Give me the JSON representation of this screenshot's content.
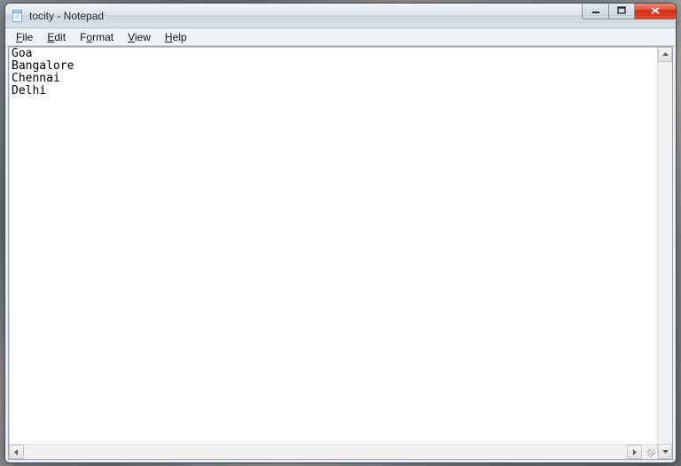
{
  "window": {
    "title": "tocity - Notepad"
  },
  "menubar": {
    "file": {
      "label": "File",
      "accel": "F"
    },
    "edit": {
      "label": "Edit",
      "accel": "E"
    },
    "format": {
      "label": "Format",
      "accel": "o"
    },
    "view": {
      "label": "View",
      "accel": "V"
    },
    "help": {
      "label": "Help",
      "accel": "H"
    }
  },
  "document": {
    "text": "Goa\nBangalore\nChennai\nDelhi"
  }
}
